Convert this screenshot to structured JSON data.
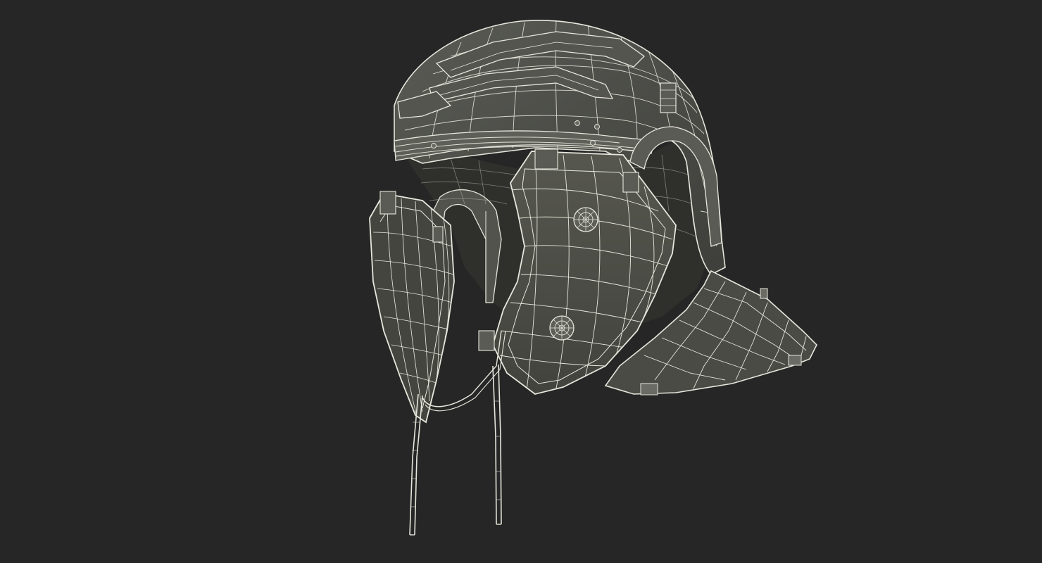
{
  "scene": {
    "subject": "roman-helmet-wireframe",
    "background_color": "#262626",
    "shell_color": "#4b4c47",
    "shell_dark_color": "#3a3b37",
    "interior_color": "#33342f",
    "wire_color": "#e6e6dc",
    "wire_dim_color": "#cfcfc4"
  }
}
